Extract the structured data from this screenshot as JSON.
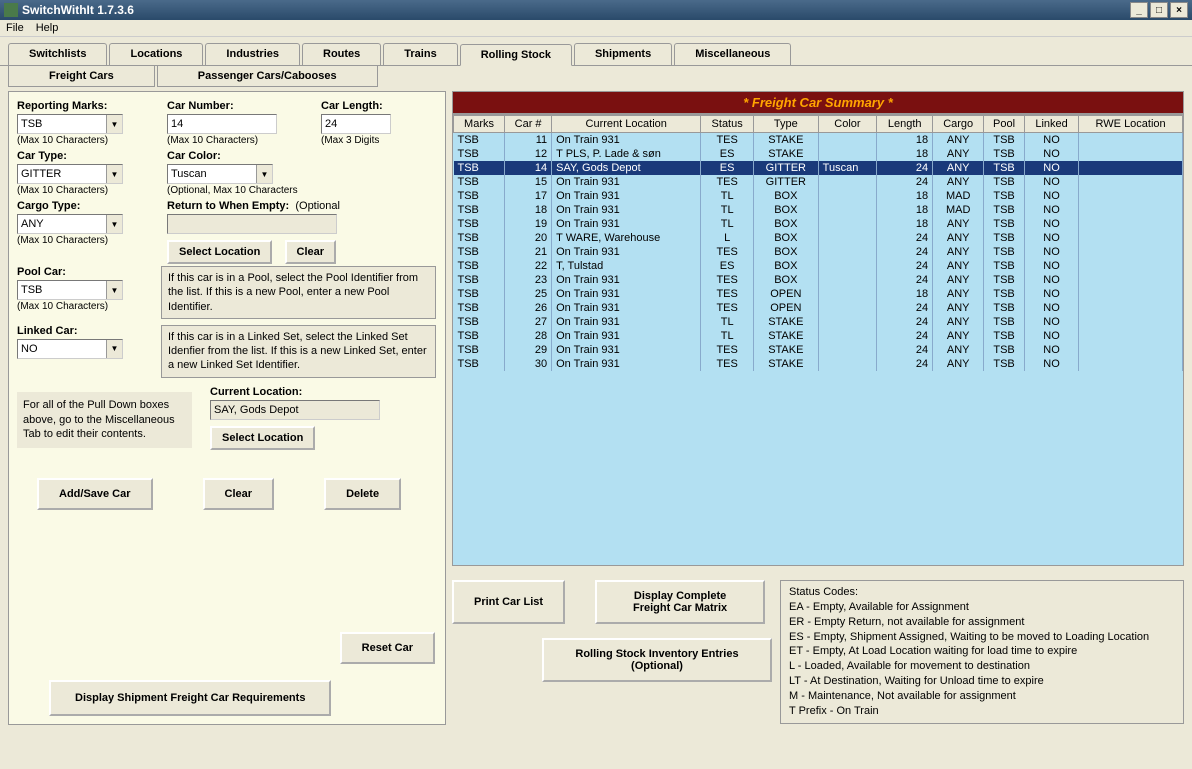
{
  "window": {
    "title": "SwitchWithIt 1.7.3.6"
  },
  "menu": {
    "file": "File",
    "help": "Help"
  },
  "main_tabs": [
    "Switchlists",
    "Locations",
    "Industries",
    "Routes",
    "Trains",
    "Rolling Stock",
    "Shipments",
    "Miscellaneous"
  ],
  "main_active": 5,
  "sub_tabs": [
    "Freight Cars",
    "Passenger Cars/Cabooses"
  ],
  "sub_active": 0,
  "form": {
    "reporting_marks": {
      "label": "Reporting Marks:",
      "value": "TSB",
      "hint": "(Max 10 Characters)"
    },
    "car_number": {
      "label": "Car Number:",
      "value": "14",
      "hint": "(Max 10 Characters)"
    },
    "car_length": {
      "label": "Car Length:",
      "value": "24",
      "hint": "(Max 3 Digits"
    },
    "car_type": {
      "label": "Car Type:",
      "value": "GITTER",
      "hint": "(Max 10 Characters)"
    },
    "car_color": {
      "label": "Car Color:",
      "value": "Tuscan",
      "hint": "(Optional, Max 10 Characters"
    },
    "cargo_type": {
      "label": "Cargo Type:",
      "value": "ANY",
      "hint": "(Max 10 Characters)"
    },
    "return_empty": {
      "label": "Return to When Empty:",
      "hint": "(Optional",
      "value": ""
    },
    "pool_car": {
      "label": "Pool Car:",
      "value": "TSB",
      "hint": "(Max 10 Characters)"
    },
    "linked_car": {
      "label": "Linked Car:",
      "value": "NO"
    },
    "current_location": {
      "label": "Current Location:",
      "value": "SAY, Gods Depot"
    },
    "pool_help": "If this car is in a Pool, select the Pool Identifier from the list.  If this is a new Pool, enter a new Pool Identifier.",
    "linked_help": "If this car is in a Linked Set, select the Linked Set Idenfier from the list.  If this is a new Linked Set, enter a new Linked Set Identifier.",
    "pulldown_help": "For all of the Pull Down boxes above, go to the Miscellaneous Tab to edit their contents."
  },
  "buttons": {
    "select_location": "Select Location",
    "clear_loc": "Clear",
    "add_save": "Add/Save Car",
    "clear": "Clear",
    "delete": "Delete",
    "reset": "Reset Car",
    "print": "Print Car List",
    "matrix": "Display Complete Freight Car Matrix",
    "requirements": "Display Shipment Freight Car Requirements",
    "inventory": "Rolling Stock Inventory Entries (Optional)"
  },
  "summary": {
    "title": "* Freight Car Summary *",
    "headers": [
      "Marks",
      "Car #",
      "Current Location",
      "Status",
      "Type",
      "Color",
      "Length",
      "Cargo",
      "Pool",
      "Linked",
      "RWE Location"
    ],
    "rows": [
      [
        "TSB",
        "11",
        "On Train 931",
        "TES",
        "STAKE",
        "",
        "18",
        "ANY",
        "TSB",
        "NO",
        ""
      ],
      [
        "TSB",
        "12",
        "T PLS, P. Lade & søn",
        "ES",
        "STAKE",
        "",
        "18",
        "ANY",
        "TSB",
        "NO",
        ""
      ],
      [
        "TSB",
        "14",
        "SAY, Gods Depot",
        "ES",
        "GITTER",
        "Tuscan",
        "24",
        "ANY",
        "TSB",
        "NO",
        ""
      ],
      [
        "TSB",
        "15",
        "On Train 931",
        "TES",
        "GITTER",
        "",
        "24",
        "ANY",
        "TSB",
        "NO",
        ""
      ],
      [
        "TSB",
        "17",
        "On Train 931",
        "TL",
        "BOX",
        "",
        "18",
        "MAD",
        "TSB",
        "NO",
        ""
      ],
      [
        "TSB",
        "18",
        "On Train 931",
        "TL",
        "BOX",
        "",
        "18",
        "MAD",
        "TSB",
        "NO",
        ""
      ],
      [
        "TSB",
        "19",
        "On Train 931",
        "TL",
        "BOX",
        "",
        "18",
        "ANY",
        "TSB",
        "NO",
        ""
      ],
      [
        "TSB",
        "20",
        "T WARE, Warehouse",
        "L",
        "BOX",
        "",
        "24",
        "ANY",
        "TSB",
        "NO",
        ""
      ],
      [
        "TSB",
        "21",
        "On Train 931",
        "TES",
        "BOX",
        "",
        "24",
        "ANY",
        "TSB",
        "NO",
        ""
      ],
      [
        "TSB",
        "22",
        "T, Tulstad",
        "ES",
        "BOX",
        "",
        "24",
        "ANY",
        "TSB",
        "NO",
        ""
      ],
      [
        "TSB",
        "23",
        "On Train 931",
        "TES",
        "BOX",
        "",
        "24",
        "ANY",
        "TSB",
        "NO",
        ""
      ],
      [
        "TSB",
        "25",
        "On Train 931",
        "TES",
        "OPEN",
        "",
        "18",
        "ANY",
        "TSB",
        "NO",
        ""
      ],
      [
        "TSB",
        "26",
        "On Train 931",
        "TES",
        "OPEN",
        "",
        "24",
        "ANY",
        "TSB",
        "NO",
        ""
      ],
      [
        "TSB",
        "27",
        "On Train 931",
        "TL",
        "STAKE",
        "",
        "24",
        "ANY",
        "TSB",
        "NO",
        ""
      ],
      [
        "TSB",
        "28",
        "On Train 931",
        "TL",
        "STAKE",
        "",
        "24",
        "ANY",
        "TSB",
        "NO",
        ""
      ],
      [
        "TSB",
        "29",
        "On Train 931",
        "TES",
        "STAKE",
        "",
        "24",
        "ANY",
        "TSB",
        "NO",
        ""
      ],
      [
        "TSB",
        "30",
        "On Train 931",
        "TES",
        "STAKE",
        "",
        "24",
        "ANY",
        "TSB",
        "NO",
        ""
      ]
    ],
    "selected": 2
  },
  "status_codes": {
    "title": "Status Codes:",
    "lines": [
      "EA - Empty, Available for Assignment",
      "ER - Empty Return, not available for assignment",
      "ES - Empty, Shipment Assigned, Waiting to be moved to Loading Location",
      "ET - Empty, At Load Location waiting for load time to expire",
      "L - Loaded, Available for movement to destination",
      "LT - At Destination, Waiting for Unload time to expire",
      "M - Maintenance, Not available for assignment",
      "T Prefix - On Train"
    ]
  }
}
